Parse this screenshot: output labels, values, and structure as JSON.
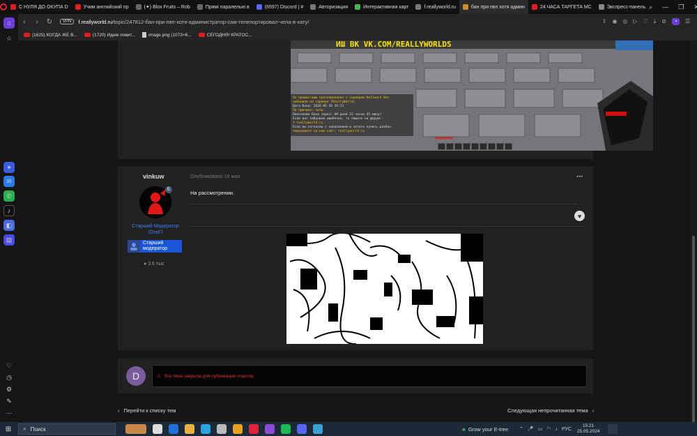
{
  "tabs": [
    {
      "title": "С НУЛЯ ДО ОКУПА D",
      "color": "#e01e1e"
    },
    {
      "title": "Учим английский пр",
      "color": "#e01e1e"
    },
    {
      "title": "(✦) Blox Fruits – Rob",
      "color": "#666"
    },
    {
      "title": "Прямі паралельні в",
      "color": "#666"
    },
    {
      "title": "(6597) Discord | #",
      "color": "#5865f2"
    },
    {
      "title": "Авторизация",
      "color": "#777"
    },
    {
      "title": "Интерактивная карт",
      "color": "#4caf50"
    },
    {
      "title": "f.reallyworld.ru",
      "color": "#777"
    },
    {
      "title": "бан при пвп хотя админ",
      "color": "#c98f2a",
      "active": true
    },
    {
      "title": "24 ЧАСА ТАРГЕТА МС",
      "color": "#e01e1e"
    },
    {
      "title": "Экспресс-панель",
      "color": "#888"
    }
  ],
  "address": {
    "vpn": "VPN",
    "domain": "f.reallyworld.ru",
    "path": "/topic/247812-бан-при-пвп-хотя-администратор-сам-телепортировал-чела-в-хату/"
  },
  "bookmarks": [
    {
      "label": "(1625) КОГДА ЖЕ В...",
      "type": "yt"
    },
    {
      "label": "(1720) Идем ловит...",
      "type": "yt"
    },
    {
      "label": "image.png (1073×6...",
      "type": "doc"
    },
    {
      "label": "СЕГОДНЯ! КРАТОС...",
      "type": "yt"
    }
  ],
  "game": {
    "banner": "ИШ ВК  VK.COM/REALLYWORLDS",
    "chat": [
      {
        "t": "По прошествию преследования с сервером Hellward Вас",
        "c": "y"
      },
      {
        "t": "забанили на сервере (ReallyWorld)",
        "c": "y"
      },
      {
        "t": "Дата бана: 2024-05-18 19:12",
        "c": "w"
      },
      {
        "t": "По причине: читы",
        "c": "y"
      },
      {
        "t": "Окончание бана через: 49 дней 23 часов 45 минут",
        "c": "w"
      },
      {
        "t": "Если вас забанили ошибочно, то пишите на форум:",
        "c": "w"
      },
      {
        "t": "f.reallyworld.ru",
        "c": "y"
      },
      {
        "t": "Если вы согласны с наказанием и хотите купить разбан",
        "c": "w"
      },
      {
        "t": "переходите на наш сайт: reallyworld.ru",
        "c": "y"
      }
    ]
  },
  "post": {
    "author": "vinkuw",
    "author_badge": "E",
    "rank": [
      "Старший Модератор",
      "(OraF)"
    ],
    "rank_badge": "Старший модератор",
    "reputation": "3.6 тыс",
    "published": "Опубликовано 18 мая",
    "menu": "•••",
    "text": "На рассмотрении.",
    "like": "♥"
  },
  "locked": {
    "avatar_letter": "D",
    "message": "Эта тема закрыта для публикации ответов."
  },
  "pager": {
    "prev": "Перейти к списку тем",
    "next": "Следующая непрочитанная тема"
  },
  "taskbar": {
    "search_placeholder": "Поиск",
    "weather": "Grow your E-tree",
    "lang": "РУС",
    "time": "15:21",
    "date": "25.05.2024"
  }
}
